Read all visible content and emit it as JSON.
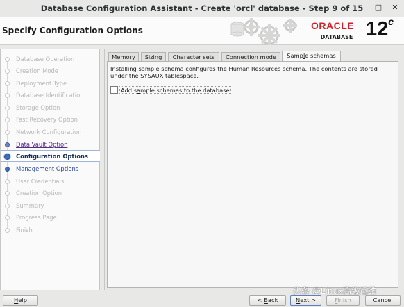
{
  "window": {
    "title": "Database Configuration Assistant - Create 'orcl' database - Step 9 of 15",
    "minimize": "–",
    "maximize": "□",
    "close": "✕"
  },
  "header": {
    "page_title": "Specify Configuration Options",
    "logo_brand": "ORACLE",
    "logo_product": "DATABASE",
    "logo_version": "12",
    "logo_suffix": "c"
  },
  "sidebar": {
    "steps": [
      {
        "label": "Database Operation",
        "state": "done"
      },
      {
        "label": "Creation Mode",
        "state": "done"
      },
      {
        "label": "Deployment Type",
        "state": "done"
      },
      {
        "label": "Database Identification",
        "state": "done"
      },
      {
        "label": "Storage Option",
        "state": "done"
      },
      {
        "label": "Fast Recovery Option",
        "state": "done"
      },
      {
        "label": "Network Configuration",
        "state": "done"
      },
      {
        "label": "Data Vault Option",
        "state": "link"
      },
      {
        "label": "Configuration Options",
        "state": "current"
      },
      {
        "label": "Management Options",
        "state": "next"
      },
      {
        "label": "User Credentials",
        "state": "pending"
      },
      {
        "label": "Creation Option",
        "state": "pending"
      },
      {
        "label": "Summary",
        "state": "pending"
      },
      {
        "label": "Progress Page",
        "state": "pending"
      },
      {
        "label": "Finish",
        "state": "pending"
      }
    ]
  },
  "tabs": [
    {
      "pre": "",
      "ul": "M",
      "post": "emory",
      "active": false
    },
    {
      "pre": "",
      "ul": "S",
      "post": "izing",
      "active": false
    },
    {
      "pre": "",
      "ul": "C",
      "post": "haracter sets",
      "active": false
    },
    {
      "pre": "C",
      "ul": "o",
      "post": "nnection mode",
      "active": false
    },
    {
      "pre": "Samp",
      "ul": "l",
      "post": "e schemas",
      "active": true
    }
  ],
  "panel": {
    "description": "Installing sample schema configures the Human Resources schema. The contents are stored under the SYSAUX tablespace.",
    "checkbox_pre": "Add s",
    "checkbox_ul": "a",
    "checkbox_post": "mple schemas to the database",
    "checkbox_checked": false
  },
  "buttons": {
    "help_ul": "H",
    "help_rest": "elp",
    "back_pre": "< ",
    "back_ul": "B",
    "back_post": "ack",
    "next_ul": "N",
    "next_post": "ext >",
    "finish_ul": "F",
    "finish_post": "inish",
    "cancel": "Cancel"
  },
  "watermark": "头条 @Linux高级运维",
  "colors": {
    "accent": "#3b6fc0",
    "oracle_red": "#d0202a",
    "link_purple": "#5a2c8c"
  }
}
